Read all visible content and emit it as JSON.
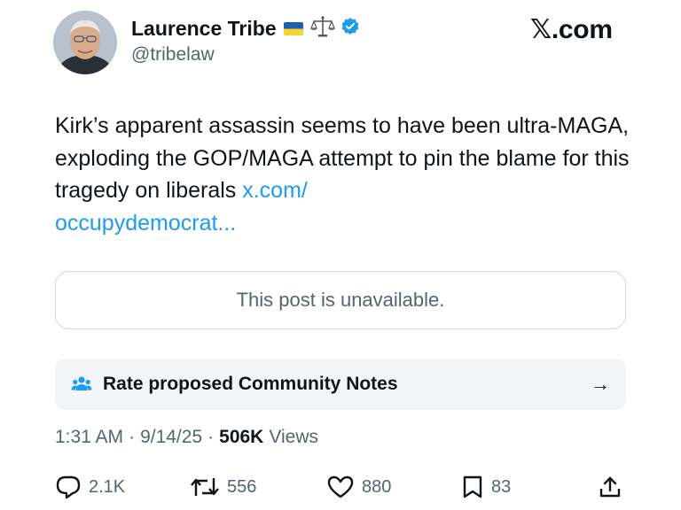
{
  "author": {
    "display_name": "Laurence Tribe",
    "handle": "@tribelaw",
    "verified": true,
    "badges": [
      "ukraine-flag-icon",
      "balance-scale-icon",
      "verified-badge-icon"
    ]
  },
  "brand": {
    "logo_text": "𝕏.com"
  },
  "post": {
    "text": "Kirk’s apparent assassin seems to have been ultra-MAGA, exploding the GOP/MAGA attempt to pin the blame for this tragedy on liberals ",
    "link_text": "x.com/\noccupydemocrat..."
  },
  "quoted_card": {
    "message": "This post is unavailable."
  },
  "community_notes": {
    "icon": "people-icon",
    "label": "Rate proposed Community Notes",
    "arrow": "→"
  },
  "meta": {
    "time": "1:31 AM",
    "date": "9/14/25",
    "separator": "·",
    "views_count": "506K",
    "views_label": "Views"
  },
  "actions": {
    "replies": "2.1K",
    "reposts": "556",
    "likes": "880",
    "bookmarks": "83"
  },
  "colors": {
    "accent": "#1d9bf0",
    "text_primary": "#0f1419",
    "text_secondary": "#536471",
    "border": "#cfd9de",
    "notes_bg": "#f2f4f5"
  }
}
